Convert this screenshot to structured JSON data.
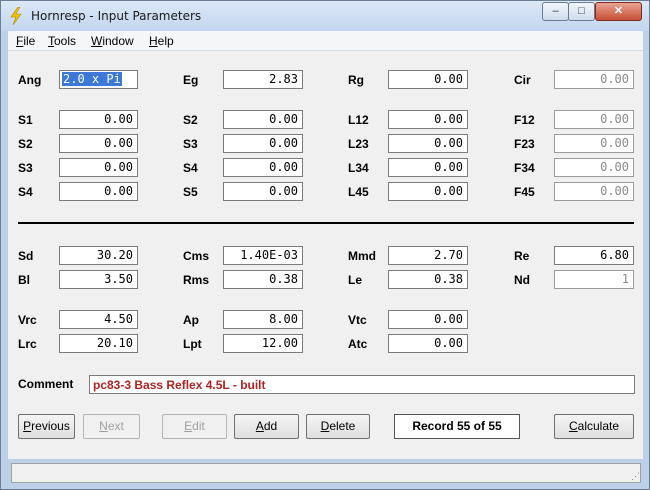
{
  "window": {
    "title": "Hornresp - Input Parameters"
  },
  "controls": {
    "minimize": "–",
    "maximize": "□",
    "close": "✕"
  },
  "menu": [
    {
      "label": "File",
      "key": "F",
      "rest": "ile"
    },
    {
      "label": "Tools",
      "key": "T",
      "rest": "ools"
    },
    {
      "label": "Window",
      "key": "W",
      "rest": "indow"
    },
    {
      "label": "Help",
      "key": "H",
      "rest": "elp"
    }
  ],
  "params": {
    "Ang": {
      "label": "Ang",
      "value": "2.0 x Pi"
    },
    "Eg": {
      "label": "Eg",
      "value": "2.83"
    },
    "Rg": {
      "label": "Rg",
      "value": "0.00"
    },
    "Cir": {
      "label": "Cir",
      "value": "0.00"
    },
    "S1": {
      "label": "S1",
      "value": "0.00"
    },
    "S2a": {
      "label": "S2",
      "value": "0.00"
    },
    "L12": {
      "label": "L12",
      "value": "0.00"
    },
    "F12": {
      "label": "F12",
      "value": "0.00"
    },
    "S2b": {
      "label": "S2",
      "value": "0.00"
    },
    "S3a": {
      "label": "S3",
      "value": "0.00"
    },
    "L23": {
      "label": "L23",
      "value": "0.00"
    },
    "F23": {
      "label": "F23",
      "value": "0.00"
    },
    "S3b": {
      "label": "S3",
      "value": "0.00"
    },
    "S4a": {
      "label": "S4",
      "value": "0.00"
    },
    "L34": {
      "label": "L34",
      "value": "0.00"
    },
    "F34": {
      "label": "F34",
      "value": "0.00"
    },
    "S4b": {
      "label": "S4",
      "value": "0.00"
    },
    "S5": {
      "label": "S5",
      "value": "0.00"
    },
    "L45": {
      "label": "L45",
      "value": "0.00"
    },
    "F45": {
      "label": "F45",
      "value": "0.00"
    },
    "Sd": {
      "label": "Sd",
      "value": "30.20"
    },
    "Cms": {
      "label": "Cms",
      "value": "1.40E-03"
    },
    "Mmd": {
      "label": "Mmd",
      "value": "2.70"
    },
    "Re": {
      "label": "Re",
      "value": "6.80"
    },
    "Bl": {
      "label": "Bl",
      "value": "3.50"
    },
    "Rms": {
      "label": "Rms",
      "value": "0.38"
    },
    "Le": {
      "label": "Le",
      "value": "0.38"
    },
    "Nd": {
      "label": "Nd",
      "value": "1"
    },
    "Vrc": {
      "label": "Vrc",
      "value": "4.50"
    },
    "Ap": {
      "label": "Ap",
      "value": "8.00"
    },
    "Vtc": {
      "label": "Vtc",
      "value": "0.00"
    },
    "Lrc": {
      "label": "Lrc",
      "value": "20.10"
    },
    "Lpt": {
      "label": "Lpt",
      "value": "12.00"
    },
    "Atc": {
      "label": "Atc",
      "value": "0.00"
    }
  },
  "comment": {
    "label": "Comment",
    "value": "pc83-3 Bass Reflex 4.5L - built"
  },
  "buttons": {
    "previous": {
      "key": "P",
      "rest": "revious"
    },
    "next": {
      "key": "N",
      "rest": "ext"
    },
    "edit": {
      "key": "E",
      "rest": "dit"
    },
    "add": {
      "key": "A",
      "rest": "dd"
    },
    "delete": {
      "key": "D",
      "rest": "elete"
    },
    "calculate": {
      "key": "C",
      "rest": "alculate"
    }
  },
  "record": "Record 55 of 55"
}
